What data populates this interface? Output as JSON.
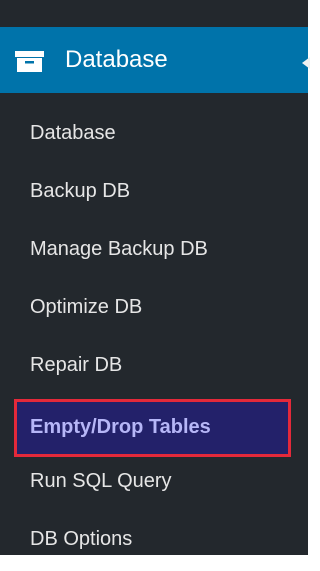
{
  "colors": {
    "sidebar_bg": "#23282d",
    "header_bg": "#0073aa",
    "item_text": "#e6e6e6",
    "active_bg": "#23216a",
    "active_text": "#b6b6f7",
    "highlight_border": "#e4293a"
  },
  "header": {
    "icon": "archive-icon",
    "label": "Database"
  },
  "menu": {
    "items": [
      {
        "label": "Database",
        "active": false
      },
      {
        "label": "Backup DB",
        "active": false
      },
      {
        "label": "Manage Backup DB",
        "active": false
      },
      {
        "label": "Optimize DB",
        "active": false
      },
      {
        "label": "Repair DB",
        "active": false
      },
      {
        "label": "Empty/Drop Tables",
        "active": true
      },
      {
        "label": "Run SQL Query",
        "active": false
      },
      {
        "label": "DB Options",
        "active": false
      }
    ]
  }
}
